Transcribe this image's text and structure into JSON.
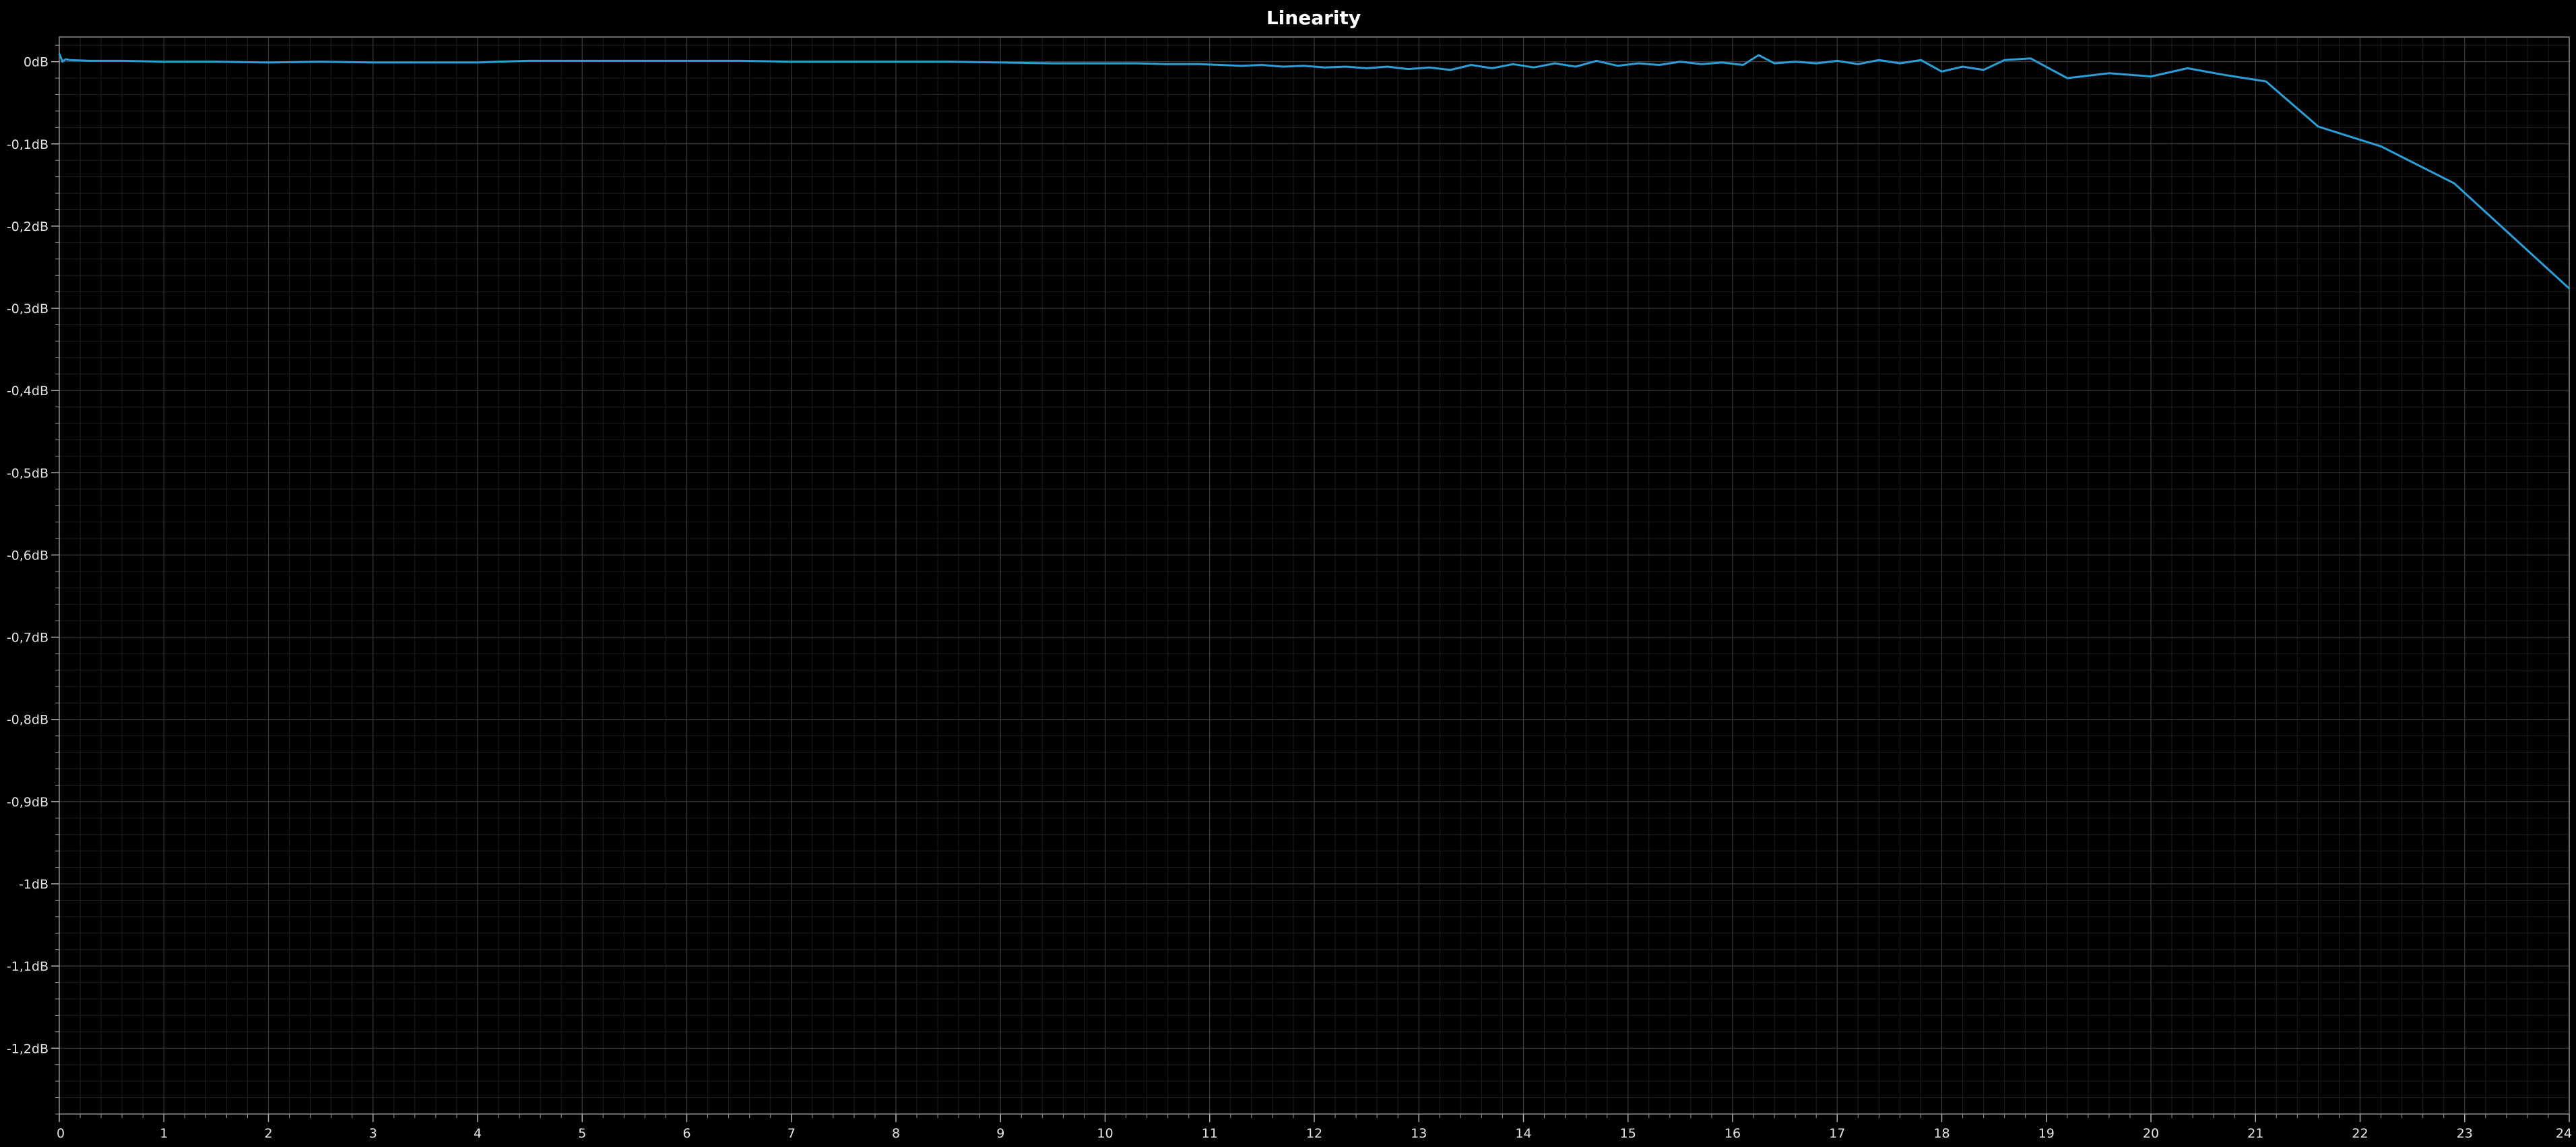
{
  "chart_data": {
    "type": "line",
    "title": "Linearity",
    "xlabel": "",
    "ylabel": "",
    "xlim": [
      0,
      24
    ],
    "ylim": [
      -1.28,
      0.03
    ],
    "x_ticks": [
      0,
      1,
      2,
      3,
      4,
      5,
      6,
      7,
      8,
      9,
      10,
      11,
      12,
      13,
      14,
      15,
      16,
      17,
      18,
      19,
      20,
      21,
      22,
      23,
      24
    ],
    "x_tick_labels": [
      "0",
      "1",
      "2",
      "3",
      "4",
      "5",
      "6",
      "7",
      "8",
      "9",
      "10",
      "11",
      "12",
      "13",
      "14",
      "15",
      "16",
      "17",
      "18",
      "19",
      "20",
      "21",
      "22",
      "23",
      "24"
    ],
    "y_ticks": [
      0,
      -0.1,
      -0.2,
      -0.3,
      -0.4,
      -0.5,
      -0.6,
      -0.7,
      -0.8,
      -0.9,
      -1.0,
      -1.1,
      -1.2
    ],
    "y_tick_labels": [
      "0dB",
      "-0,1dB",
      "-0,2dB",
      "-0,3dB",
      "-0,4dB",
      "-0,5dB",
      "-0,6dB",
      "-0,7dB",
      "-0,8dB",
      "-0,9dB",
      "-1dB",
      "-1,1dB",
      "-1,2dB"
    ],
    "grid": true,
    "legend": "none",
    "series": [
      {
        "color": "#2a9fd8",
        "x": [
          0.0,
          0.03,
          0.06,
          0.1,
          0.3,
          0.6,
          1.0,
          1.5,
          2.0,
          2.5,
          3.0,
          3.5,
          4.0,
          4.2,
          4.5,
          5.0,
          5.5,
          6.0,
          6.5,
          7.0,
          7.5,
          8.0,
          8.5,
          9.0,
          9.5,
          10.0,
          10.3,
          10.6,
          10.9,
          11.1,
          11.3,
          11.5,
          11.7,
          11.9,
          12.1,
          12.3,
          12.5,
          12.7,
          12.9,
          13.1,
          13.3,
          13.5,
          13.7,
          13.9,
          14.1,
          14.3,
          14.5,
          14.7,
          14.9,
          15.1,
          15.3,
          15.5,
          15.7,
          15.9,
          16.1,
          16.25,
          16.4,
          16.6,
          16.8,
          17.0,
          17.2,
          17.4,
          17.6,
          17.8,
          18.0,
          18.2,
          18.4,
          18.6,
          18.85,
          19.2,
          19.6,
          20.0,
          20.35,
          20.7,
          21.1,
          21.6,
          22.2,
          22.9,
          24.0
        ],
        "y": [
          0.01,
          0.0,
          0.003,
          0.002,
          0.001,
          0.001,
          0.0,
          0.0,
          -0.001,
          0.0,
          -0.001,
          -0.001,
          -0.001,
          0.0,
          0.001,
          0.001,
          0.001,
          0.001,
          0.001,
          0.0,
          0.0,
          0.0,
          0.0,
          -0.001,
          -0.002,
          -0.002,
          -0.002,
          -0.003,
          -0.003,
          -0.004,
          -0.005,
          -0.004,
          -0.006,
          -0.005,
          -0.007,
          -0.006,
          -0.008,
          -0.006,
          -0.009,
          -0.007,
          -0.01,
          -0.004,
          -0.008,
          -0.003,
          -0.007,
          -0.002,
          -0.006,
          0.001,
          -0.005,
          -0.002,
          -0.004,
          0.0,
          -0.003,
          -0.001,
          -0.004,
          0.008,
          -0.002,
          0.0,
          -0.002,
          0.001,
          -0.003,
          0.002,
          -0.002,
          0.002,
          -0.012,
          -0.006,
          -0.01,
          0.002,
          0.004,
          -0.02,
          -0.014,
          -0.018,
          -0.008,
          -0.016,
          -0.024,
          -0.079,
          -0.103,
          -0.148,
          -0.276
        ]
      }
    ]
  }
}
